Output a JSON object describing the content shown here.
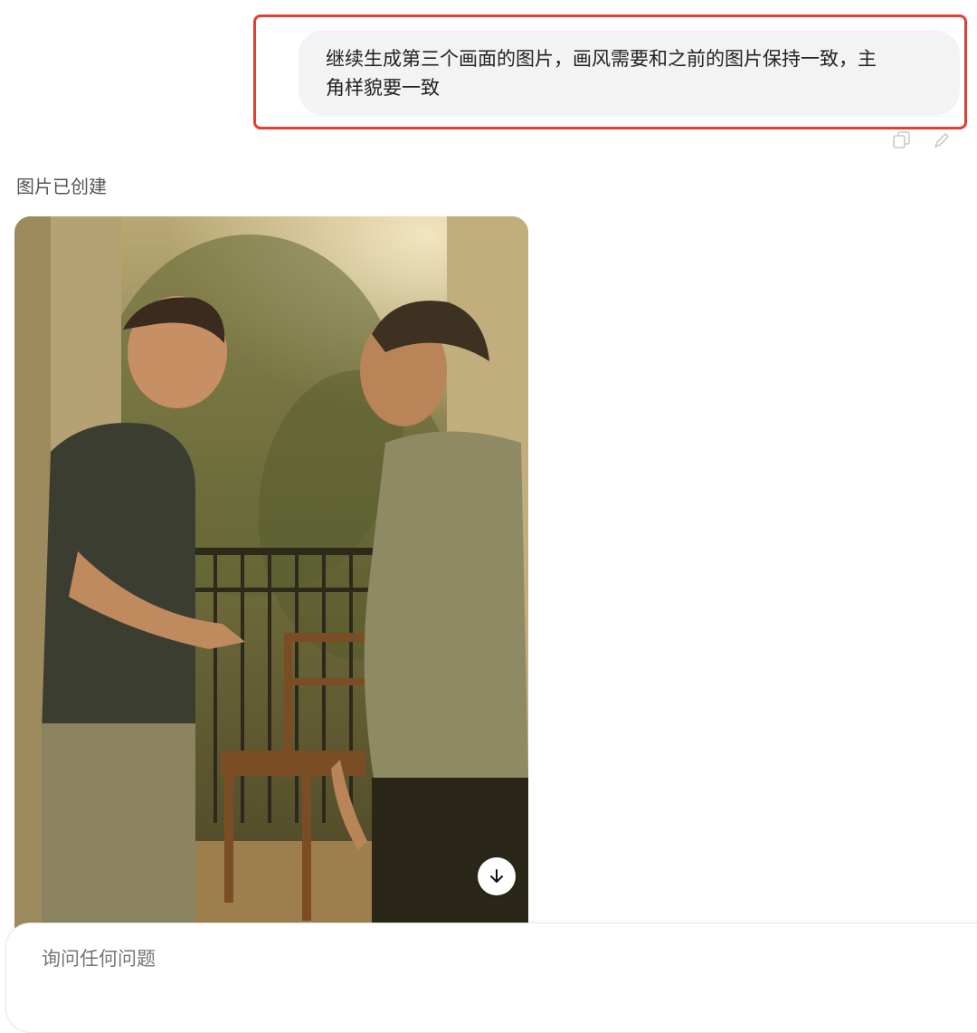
{
  "user_message": {
    "text_line1": "继续生成第三个画面的图片，画风需要和之前的图片保持一致，主",
    "text_line2": "角样貌要一致"
  },
  "message_actions": [
    "copy-icon",
    "edit-icon"
  ],
  "assistant": {
    "status": "图片已创建",
    "image_alt": "image-generation-result",
    "download_icon": "arrow-down-icon"
  },
  "composer": {
    "placeholder": "询问任何问题"
  },
  "colors": {
    "highlight": "#e0402f",
    "bubble": "#f3f3f3",
    "placeholder": "#9a9a9a"
  }
}
